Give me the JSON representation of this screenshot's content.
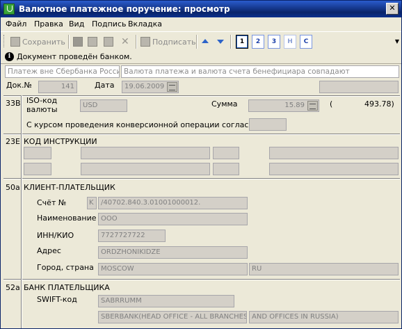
{
  "window": {
    "title": "Валютное платежное поручение: просмотр",
    "close_glyph": "✕"
  },
  "menu": {
    "items": [
      "Файл",
      "Правка",
      "Вид",
      "Подпись",
      "Вкладка"
    ]
  },
  "toolbar": {
    "save_label": "Сохранить",
    "sign_label": "Подписать",
    "pages": [
      "1",
      "2",
      "3",
      "H",
      "C"
    ],
    "active_page": "1",
    "more_glyph": "▼"
  },
  "info": {
    "icon_glyph": "i",
    "text": "Документ проведён банком."
  },
  "header": {
    "payment_type": "Платеж вне Сбербанка России",
    "currency_note": "Валюта платежа и валюта счета бенефициара совпадают",
    "doc_no_label": "Док.№",
    "doc_no": "141",
    "date_label": "Дата",
    "date": "19.06.2009"
  },
  "s33b": {
    "code": "33B",
    "iso_label_1": "ISO-код",
    "iso_label_2": "валюты",
    "iso_value": "USD",
    "sum_label": "Сумма",
    "sum_value": "15.89",
    "converted_open": "(",
    "converted_value": "493.78)",
    "rate_label": "С курсом проведения конверсионной операции согласны"
  },
  "s23e": {
    "code": "23E",
    "title": "КОД ИНСТРУКЦИИ"
  },
  "s50a": {
    "code": "50a",
    "title": "КЛИЕНТ-ПЛАТЕЛЬЩИК",
    "account_label": "Счёт №",
    "account_prefix": "K",
    "account_value": "/40702.840.3.01001000012.",
    "name_label": "Наименование",
    "name_value": "ООО",
    "inn_label": "ИНН/КИО",
    "inn_value": "7727727722",
    "address_label": "Адрес",
    "address_value": "ORDZHONIKIDZE",
    "city_label": "Город, страна",
    "city_value": "MOSCOW",
    "country_value": "RU"
  },
  "s52a": {
    "code": "52a",
    "title": "БАНК ПЛАТЕЛЬЩИКА",
    "swift_label": "SWIFT-код",
    "swift_value": "SABRRUMM",
    "bank_name_1": "SBERBANK(HEAD OFFICE - ALL BRANCHES",
    "bank_name_2": "AND OFFICES IN RUSSIA)"
  }
}
